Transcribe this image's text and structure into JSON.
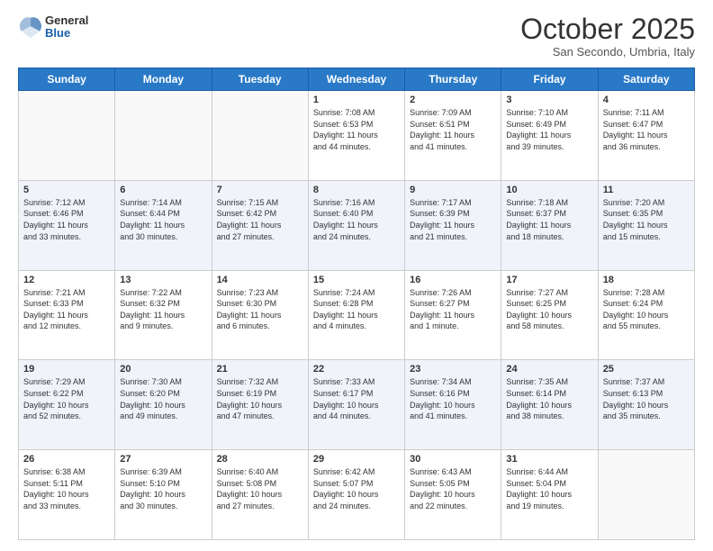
{
  "header": {
    "logo": {
      "general": "General",
      "blue": "Blue"
    },
    "title": "October 2025",
    "subtitle": "San Secondo, Umbria, Italy"
  },
  "weekdays": [
    "Sunday",
    "Monday",
    "Tuesday",
    "Wednesday",
    "Thursday",
    "Friday",
    "Saturday"
  ],
  "rows": [
    {
      "cells": [
        {
          "day": "",
          "text": ""
        },
        {
          "day": "",
          "text": ""
        },
        {
          "day": "",
          "text": ""
        },
        {
          "day": "1",
          "text": "Sunrise: 7:08 AM\nSunset: 6:53 PM\nDaylight: 11 hours\nand 44 minutes."
        },
        {
          "day": "2",
          "text": "Sunrise: 7:09 AM\nSunset: 6:51 PM\nDaylight: 11 hours\nand 41 minutes."
        },
        {
          "day": "3",
          "text": "Sunrise: 7:10 AM\nSunset: 6:49 PM\nDaylight: 11 hours\nand 39 minutes."
        },
        {
          "day": "4",
          "text": "Sunrise: 7:11 AM\nSunset: 6:47 PM\nDaylight: 11 hours\nand 36 minutes."
        }
      ]
    },
    {
      "cells": [
        {
          "day": "5",
          "text": "Sunrise: 7:12 AM\nSunset: 6:46 PM\nDaylight: 11 hours\nand 33 minutes."
        },
        {
          "day": "6",
          "text": "Sunrise: 7:14 AM\nSunset: 6:44 PM\nDaylight: 11 hours\nand 30 minutes."
        },
        {
          "day": "7",
          "text": "Sunrise: 7:15 AM\nSunset: 6:42 PM\nDaylight: 11 hours\nand 27 minutes."
        },
        {
          "day": "8",
          "text": "Sunrise: 7:16 AM\nSunset: 6:40 PM\nDaylight: 11 hours\nand 24 minutes."
        },
        {
          "day": "9",
          "text": "Sunrise: 7:17 AM\nSunset: 6:39 PM\nDaylight: 11 hours\nand 21 minutes."
        },
        {
          "day": "10",
          "text": "Sunrise: 7:18 AM\nSunset: 6:37 PM\nDaylight: 11 hours\nand 18 minutes."
        },
        {
          "day": "11",
          "text": "Sunrise: 7:20 AM\nSunset: 6:35 PM\nDaylight: 11 hours\nand 15 minutes."
        }
      ]
    },
    {
      "cells": [
        {
          "day": "12",
          "text": "Sunrise: 7:21 AM\nSunset: 6:33 PM\nDaylight: 11 hours\nand 12 minutes."
        },
        {
          "day": "13",
          "text": "Sunrise: 7:22 AM\nSunset: 6:32 PM\nDaylight: 11 hours\nand 9 minutes."
        },
        {
          "day": "14",
          "text": "Sunrise: 7:23 AM\nSunset: 6:30 PM\nDaylight: 11 hours\nand 6 minutes."
        },
        {
          "day": "15",
          "text": "Sunrise: 7:24 AM\nSunset: 6:28 PM\nDaylight: 11 hours\nand 4 minutes."
        },
        {
          "day": "16",
          "text": "Sunrise: 7:26 AM\nSunset: 6:27 PM\nDaylight: 11 hours\nand 1 minute."
        },
        {
          "day": "17",
          "text": "Sunrise: 7:27 AM\nSunset: 6:25 PM\nDaylight: 10 hours\nand 58 minutes."
        },
        {
          "day": "18",
          "text": "Sunrise: 7:28 AM\nSunset: 6:24 PM\nDaylight: 10 hours\nand 55 minutes."
        }
      ]
    },
    {
      "cells": [
        {
          "day": "19",
          "text": "Sunrise: 7:29 AM\nSunset: 6:22 PM\nDaylight: 10 hours\nand 52 minutes."
        },
        {
          "day": "20",
          "text": "Sunrise: 7:30 AM\nSunset: 6:20 PM\nDaylight: 10 hours\nand 49 minutes."
        },
        {
          "day": "21",
          "text": "Sunrise: 7:32 AM\nSunset: 6:19 PM\nDaylight: 10 hours\nand 47 minutes."
        },
        {
          "day": "22",
          "text": "Sunrise: 7:33 AM\nSunset: 6:17 PM\nDaylight: 10 hours\nand 44 minutes."
        },
        {
          "day": "23",
          "text": "Sunrise: 7:34 AM\nSunset: 6:16 PM\nDaylight: 10 hours\nand 41 minutes."
        },
        {
          "day": "24",
          "text": "Sunrise: 7:35 AM\nSunset: 6:14 PM\nDaylight: 10 hours\nand 38 minutes."
        },
        {
          "day": "25",
          "text": "Sunrise: 7:37 AM\nSunset: 6:13 PM\nDaylight: 10 hours\nand 35 minutes."
        }
      ]
    },
    {
      "cells": [
        {
          "day": "26",
          "text": "Sunrise: 6:38 AM\nSunset: 5:11 PM\nDaylight: 10 hours\nand 33 minutes."
        },
        {
          "day": "27",
          "text": "Sunrise: 6:39 AM\nSunset: 5:10 PM\nDaylight: 10 hours\nand 30 minutes."
        },
        {
          "day": "28",
          "text": "Sunrise: 6:40 AM\nSunset: 5:08 PM\nDaylight: 10 hours\nand 27 minutes."
        },
        {
          "day": "29",
          "text": "Sunrise: 6:42 AM\nSunset: 5:07 PM\nDaylight: 10 hours\nand 24 minutes."
        },
        {
          "day": "30",
          "text": "Sunrise: 6:43 AM\nSunset: 5:05 PM\nDaylight: 10 hours\nand 22 minutes."
        },
        {
          "day": "31",
          "text": "Sunrise: 6:44 AM\nSunset: 5:04 PM\nDaylight: 10 hours\nand 19 minutes."
        },
        {
          "day": "",
          "text": ""
        }
      ]
    }
  ]
}
